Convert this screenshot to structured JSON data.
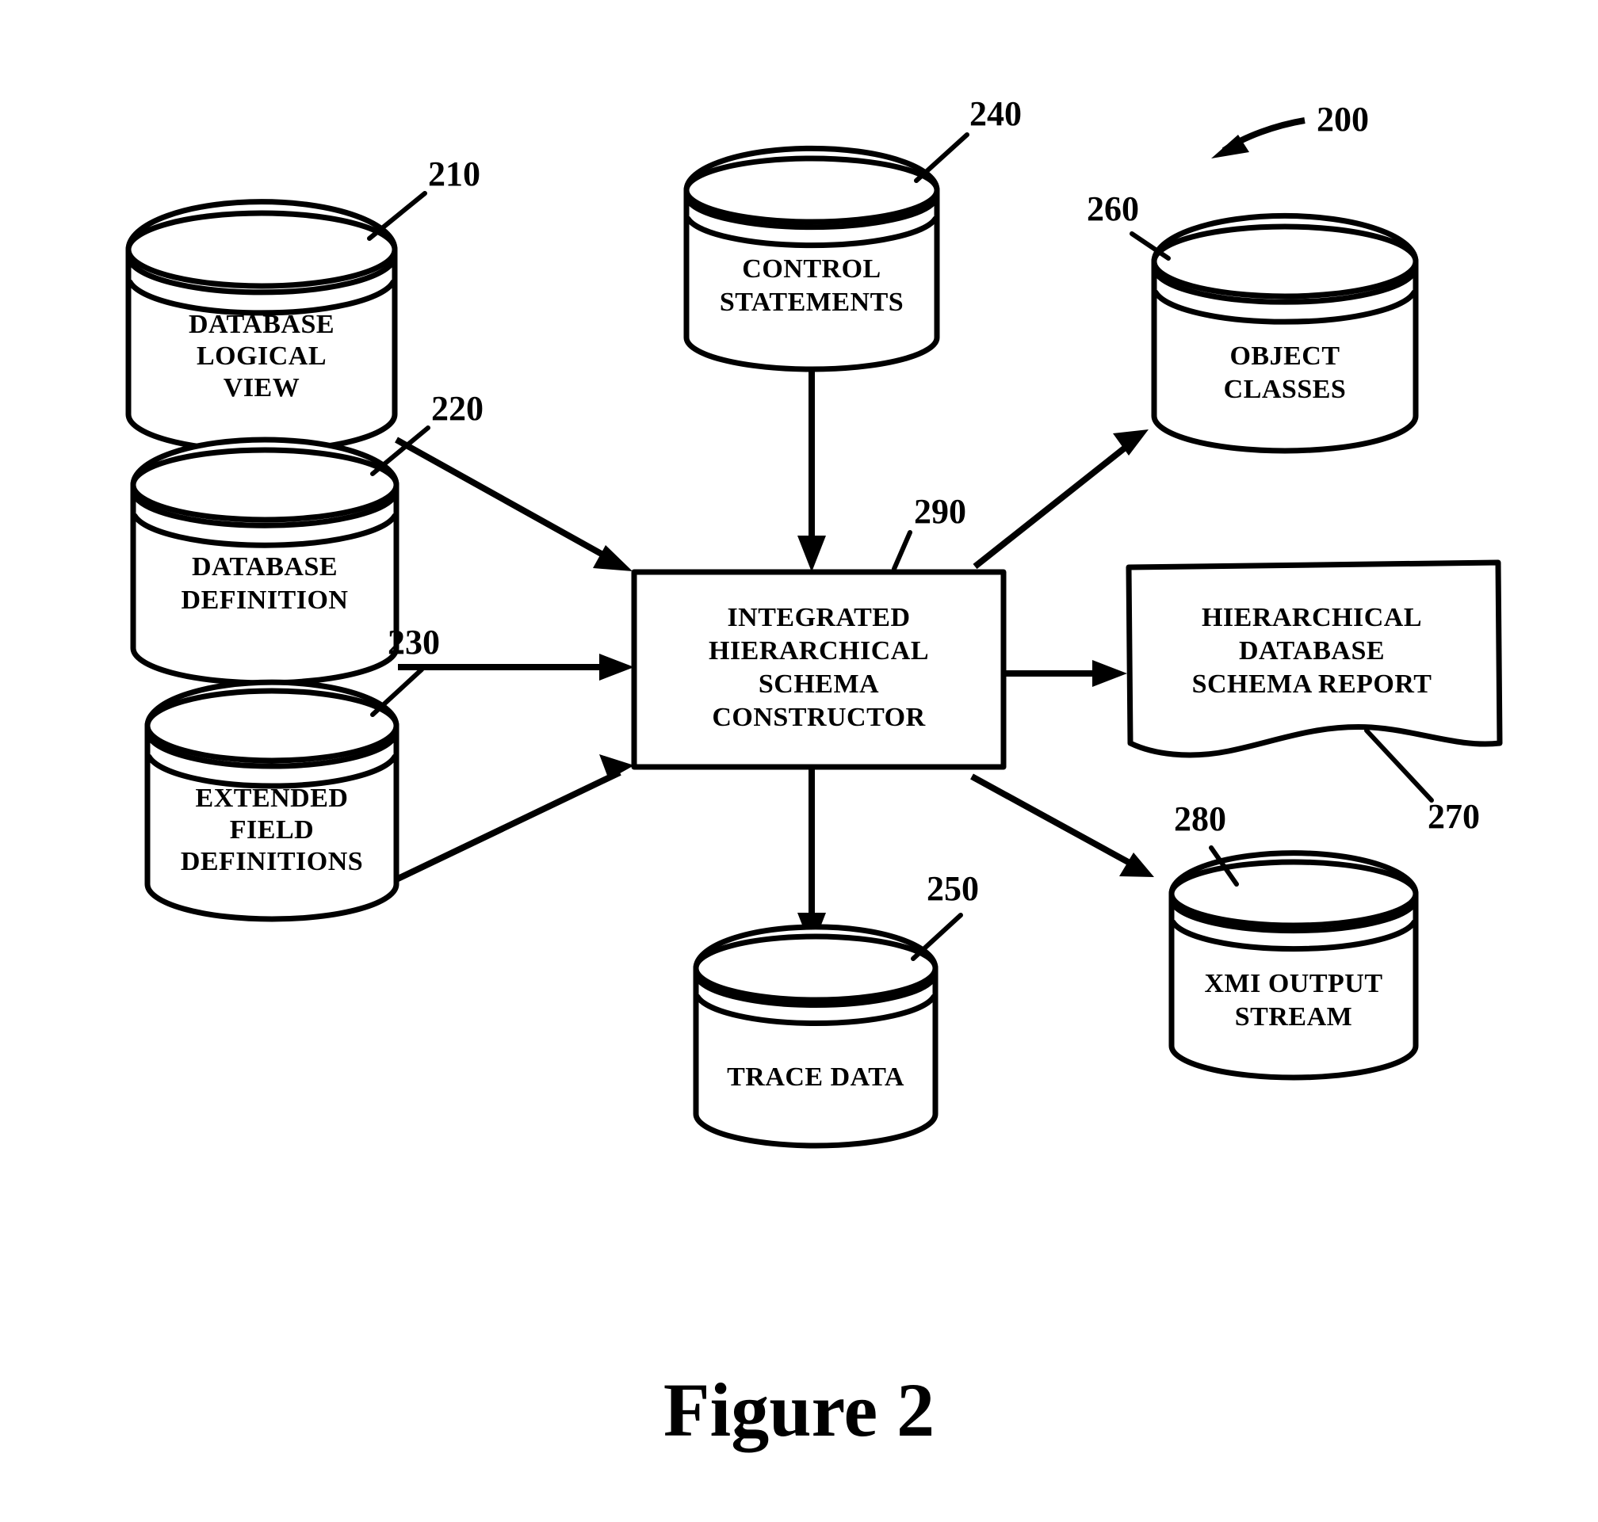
{
  "figure": {
    "caption": "Figure 2",
    "system_ref": "200"
  },
  "nodes": [
    {
      "id": "database-logical-view",
      "ref": "210",
      "shape": "cylinder",
      "lines": [
        "DATABASE",
        "LOGICAL",
        "VIEW"
      ]
    },
    {
      "id": "database-definition",
      "ref": "220",
      "shape": "cylinder",
      "lines": [
        "DATABASE",
        "DEFINITION"
      ]
    },
    {
      "id": "extended-field-definitions",
      "ref": "230",
      "shape": "cylinder",
      "lines": [
        "EXTENDED",
        "FIELD",
        "DEFINITIONS"
      ]
    },
    {
      "id": "control-statements",
      "ref": "240",
      "shape": "cylinder",
      "lines": [
        "CONTROL",
        "STATEMENTS"
      ]
    },
    {
      "id": "trace-data",
      "ref": "250",
      "shape": "cylinder",
      "lines": [
        "TRACE DATA"
      ]
    },
    {
      "id": "object-classes",
      "ref": "260",
      "shape": "cylinder",
      "lines": [
        "OBJECT",
        "CLASSES"
      ]
    },
    {
      "id": "hierarchical-database-schema-report",
      "ref": "270",
      "shape": "document",
      "lines": [
        "HIERARCHICAL",
        "DATABASE",
        "SCHEMA REPORT"
      ]
    },
    {
      "id": "xmi-output-stream",
      "ref": "280",
      "shape": "cylinder",
      "lines": [
        "XMI OUTPUT",
        "STREAM"
      ]
    },
    {
      "id": "integrated-hierarchical-schema-constructor",
      "ref": "290",
      "shape": "rectangle",
      "lines": [
        "INTEGRATED",
        "HIERARCHICAL",
        "SCHEMA",
        "CONSTRUCTOR"
      ]
    }
  ],
  "colors": {
    "ink": "#000000",
    "paper": "#ffffff"
  }
}
